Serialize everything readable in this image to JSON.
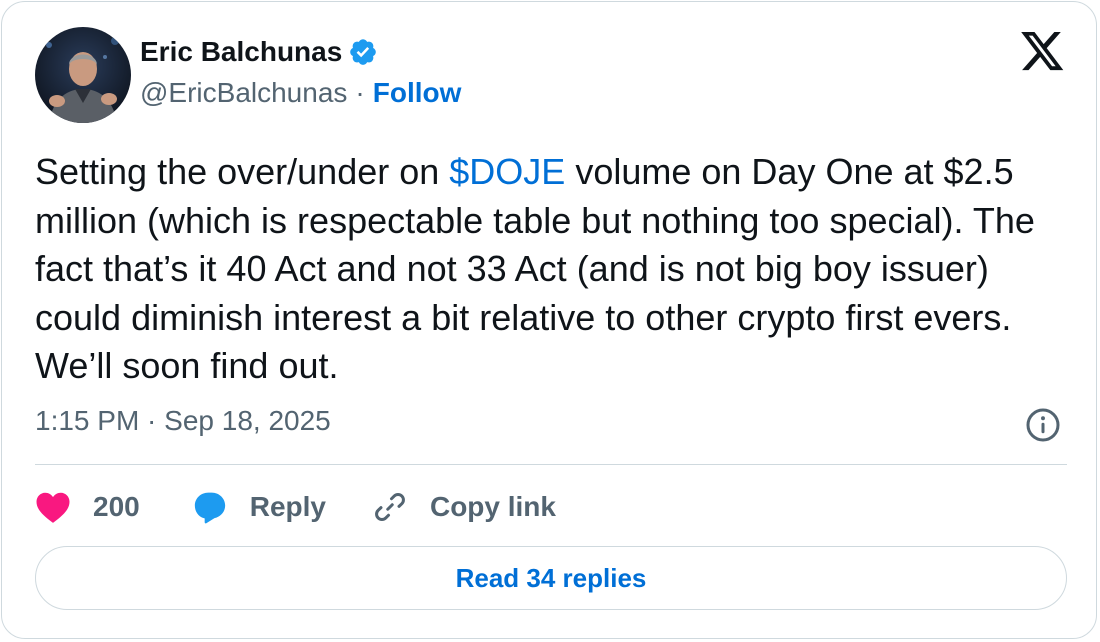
{
  "author": {
    "name": "Eric Balchunas",
    "handle": "@EricBalchunas",
    "separator": "·",
    "follow_label": "Follow",
    "verified": true
  },
  "tweet": {
    "text_before_cashtag": "Setting the over/under on ",
    "cashtag": "$DOJE",
    "text_after_cashtag": " volume on Day One at $2.5 million (which is respectable table but nothing too special). The fact that’s it 40 Act and not 33 Act (and is not big boy issuer) could diminish interest a bit relative to other crypto first evers. We’ll soon find out.",
    "timestamp": "1:15 PM · Sep 18, 2025"
  },
  "actions": {
    "like_count": "200",
    "reply_label": "Reply",
    "copy_link_label": "Copy link"
  },
  "read_replies_label": "Read 34 replies",
  "colors": {
    "link": "#006fd6",
    "verified": "#1d9bf0",
    "like": "#f91880",
    "text": "#0f1419",
    "muted": "#536471",
    "border": "#cfd9de"
  },
  "icons": [
    "verified-badge-icon",
    "x-logo-icon",
    "info-icon",
    "heart-icon",
    "reply-bubble-icon",
    "link-icon"
  ]
}
